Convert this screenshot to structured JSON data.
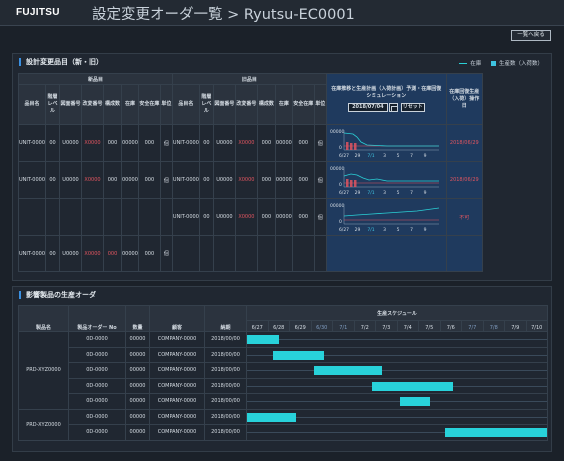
{
  "header": {
    "logo": "FUJITSU",
    "title": "設定変更オーダ一覧 > Ryutsu-EC0001"
  },
  "toolbar": {
    "back_label": "一覧へ戻る"
  },
  "panel1": {
    "title": "設計変更品目（新・旧）",
    "legend": {
      "stock": "在庫",
      "production": "生産数（入荷数）"
    },
    "new_group": "新品目",
    "old_group": "旧品目",
    "new_headers": [
      "品目名",
      "階層レベル",
      "図面番号",
      "改変番号",
      "構成数",
      "在庫",
      "安全在庫",
      "単位"
    ],
    "old_headers": [
      "品目名",
      "階層レベル",
      "図面番号",
      "改変番号",
      "構成数",
      "在庫",
      "安全在庫",
      "単位"
    ],
    "sim_header": "在庫推移と生産計画（入荷計画）予測・在庫回復シミュレーション",
    "sim_date": "2018/07/04",
    "sim_reset": "リセット",
    "result_header": "在庫回復生産（入荷）操作日",
    "chart_y_label": "00000",
    "chart_x_ticks": [
      "6/27",
      "29",
      "7/1",
      "3",
      "5",
      "7",
      "9"
    ],
    "rows": [
      {
        "n": [
          "UNIT-0000",
          "00",
          "U0000",
          "X0000",
          "000",
          "00000",
          "000",
          "個"
        ],
        "o": [
          "UNIT-0000",
          "00",
          "U0000",
          "X0000",
          "000",
          "00000",
          "000",
          "個"
        ],
        "result": "2018/06/29"
      },
      {
        "n": [
          "UNIT-0000",
          "00",
          "U0000",
          "X0000",
          "000",
          "00000",
          "000",
          "個"
        ],
        "o": [
          "UNIT-0000",
          "00",
          "U0000",
          "X0000",
          "000",
          "00000",
          "000",
          "個"
        ],
        "result": "2018/06/29"
      },
      {
        "n": [
          "",
          "",
          "",
          "",
          "",
          "",
          "",
          ""
        ],
        "o": [
          "UNIT-0000",
          "00",
          "U0000",
          "X0000",
          "000",
          "00000",
          "000",
          "個"
        ],
        "result": "不可"
      },
      {
        "n": [
          "UNIT-0000",
          "00",
          "U0000",
          "X0000",
          "000",
          "00000",
          "000",
          "個"
        ],
        "o": [
          "",
          "",
          "",
          "",
          "",
          "",
          "",
          ""
        ],
        "result": ""
      }
    ]
  },
  "panel2": {
    "title": "影響製品の生産オーダ",
    "headers": [
      "製品名",
      "製品オーダー No",
      "数量",
      "顧客",
      "納期"
    ],
    "schedule_label": "生産スケジュール",
    "days": [
      "6/27",
      "6/28",
      "6/29",
      "6/30",
      "7/1",
      "7/2",
      "7/3",
      "7/4",
      "7/5",
      "7/6",
      "7/7",
      "7/8",
      "7/9",
      "7/10"
    ],
    "groups": [
      {
        "product": "PRD-XYZ0000",
        "orders": [
          {
            "order": "0D-0000",
            "qty": "00000",
            "customer": "COMPANY-0000",
            "due": "2018/00/00",
            "bar": [
              0,
              1.5
            ]
          },
          {
            "order": "0D-0000",
            "qty": "00000",
            "customer": "COMPANY-0000",
            "due": "2018/00/00",
            "bar": [
              1.2,
              3.6
            ]
          },
          {
            "order": "0D-0000",
            "qty": "00000",
            "customer": "COMPANY-0000",
            "due": "2018/00/00",
            "bar": [
              3.1,
              6.3
            ]
          },
          {
            "order": "0D-0000",
            "qty": "00000",
            "customer": "COMPANY-0000",
            "due": "2018/00/00",
            "bar": [
              5.8,
              9.6
            ]
          },
          {
            "order": "0D-0000",
            "qty": "00000",
            "customer": "COMPANY-0000",
            "due": "2018/00/00",
            "bar": [
              7.1,
              8.5
            ]
          }
        ]
      },
      {
        "product": "PRD-XYZ0000",
        "orders": [
          {
            "order": "0D-0000",
            "qty": "00000",
            "customer": "COMPANY-0000",
            "due": "2018/00/00",
            "bar": [
              0,
              2.3
            ]
          },
          {
            "order": "0D-0000",
            "qty": "00000",
            "customer": "COMPANY-0000",
            "due": "2018/00/00",
            "bar": [
              9.2,
              14
            ]
          }
        ]
      }
    ]
  },
  "colors": {
    "bg": "#1b2129",
    "panel": "#202731",
    "accent": "#3a8fe0",
    "bar": "#28d2da",
    "alert": "#e05560",
    "sim_bg": "#1f3a5e"
  }
}
